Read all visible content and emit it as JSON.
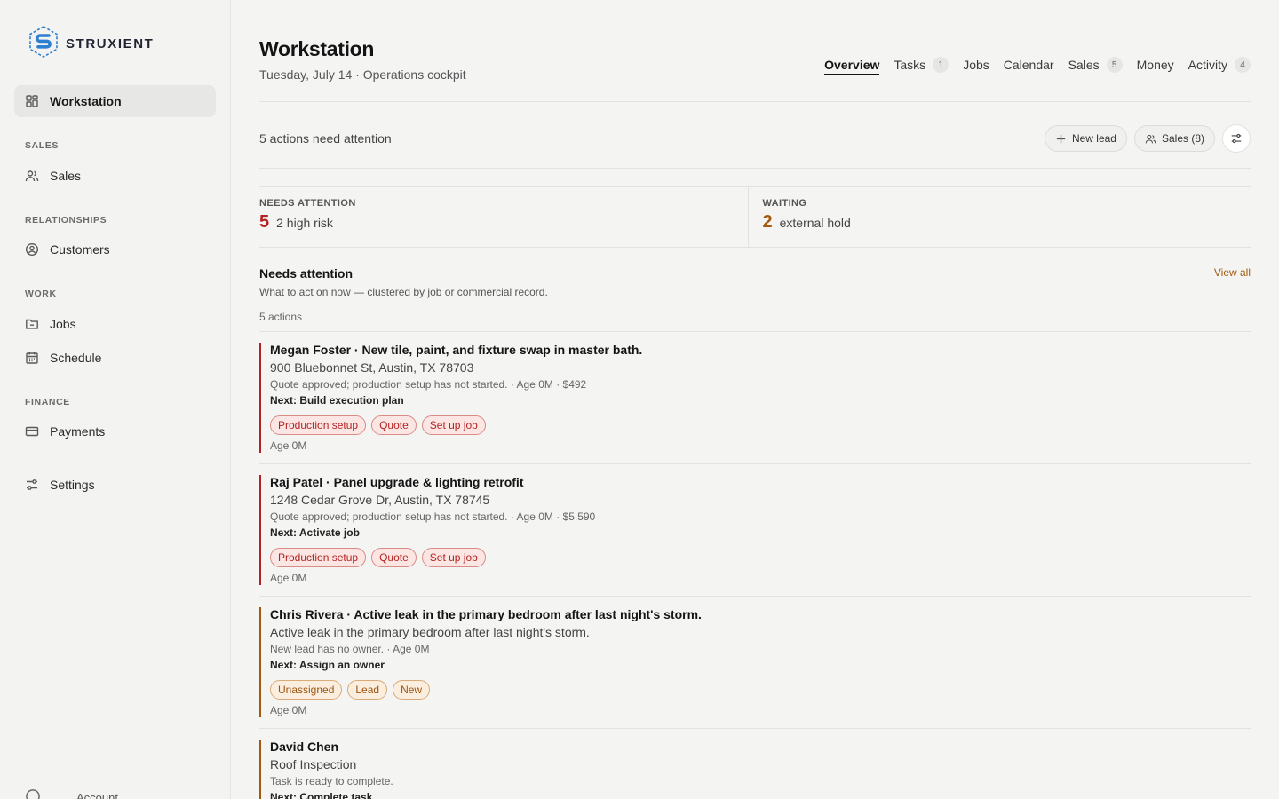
{
  "brand": {
    "name": "STRUXIENT"
  },
  "sidebar": {
    "workstation": "Workstation",
    "sections": {
      "sales": "SALES",
      "relationships": "RELATIONSHIPS",
      "work": "WORK",
      "finance": "FINANCE"
    },
    "items": {
      "sales": "Sales",
      "customers": "Customers",
      "jobs": "Jobs",
      "schedule": "Schedule",
      "payments": "Payments",
      "settings": "Settings"
    },
    "account": "Account"
  },
  "header": {
    "title": "Workstation",
    "subtitle": "Tuesday, July 14 · Operations cockpit"
  },
  "tabs": [
    {
      "label": "Overview",
      "count": ""
    },
    {
      "label": "Tasks",
      "count": "1"
    },
    {
      "label": "Jobs",
      "count": ""
    },
    {
      "label": "Calendar",
      "count": ""
    },
    {
      "label": "Sales",
      "count": "5"
    },
    {
      "label": "Money",
      "count": ""
    },
    {
      "label": "Activity",
      "count": "4"
    }
  ],
  "toolbar": {
    "attention_text": "5 actions need attention",
    "new_lead": "New lead",
    "sales_filter": "Sales (8)"
  },
  "stats": {
    "needs_attention": {
      "label": "NEEDS ATTENTION",
      "value": "5",
      "desc": "2 high risk"
    },
    "waiting": {
      "label": "WAITING",
      "value": "2",
      "desc": "external hold"
    }
  },
  "section": {
    "title": "Needs attention",
    "desc": "What to act on now — clustered by job or commercial record.",
    "count": "5 actions",
    "view_all": "View all"
  },
  "cards": [
    {
      "title": "Megan Foster · New tile, paint, and fixture swap in master bath.",
      "sub": "900 Bluebonnet St, Austin, TX 78703",
      "meta": "Quote approved; production setup has not started. · Age 0M · $492",
      "next": "Next: Build execution plan",
      "tags": [
        "Production setup",
        "Quote",
        "Set up job"
      ],
      "age": "Age 0M",
      "tone": "red"
    },
    {
      "title": "Raj Patel · Panel upgrade & lighting retrofit",
      "sub": "1248 Cedar Grove Dr, Austin, TX 78745",
      "meta": "Quote approved; production setup has not started. · Age 0M · $5,590",
      "next": "Next: Activate job",
      "tags": [
        "Production setup",
        "Quote",
        "Set up job"
      ],
      "age": "Age 0M",
      "tone": "red"
    },
    {
      "title": "Chris Rivera · Active leak in the primary bedroom after last night's storm.",
      "sub": "Active leak in the primary bedroom after last night's storm.",
      "meta": "New lead has no owner. · Age 0M",
      "next": "Next: Assign an owner",
      "tags": [
        "Unassigned",
        "Lead",
        "New"
      ],
      "age": "Age 0M",
      "tone": "amber"
    },
    {
      "title": "David Chen",
      "sub": "Roof Inspection",
      "meta": "Task is ready to complete.",
      "next": "Next: Complete task",
      "tags": [],
      "age": "",
      "tone": "amber"
    }
  ],
  "colors": {
    "red": "#b42323",
    "amber": "#a35a10",
    "brand_blue": "#2d7fd0"
  }
}
